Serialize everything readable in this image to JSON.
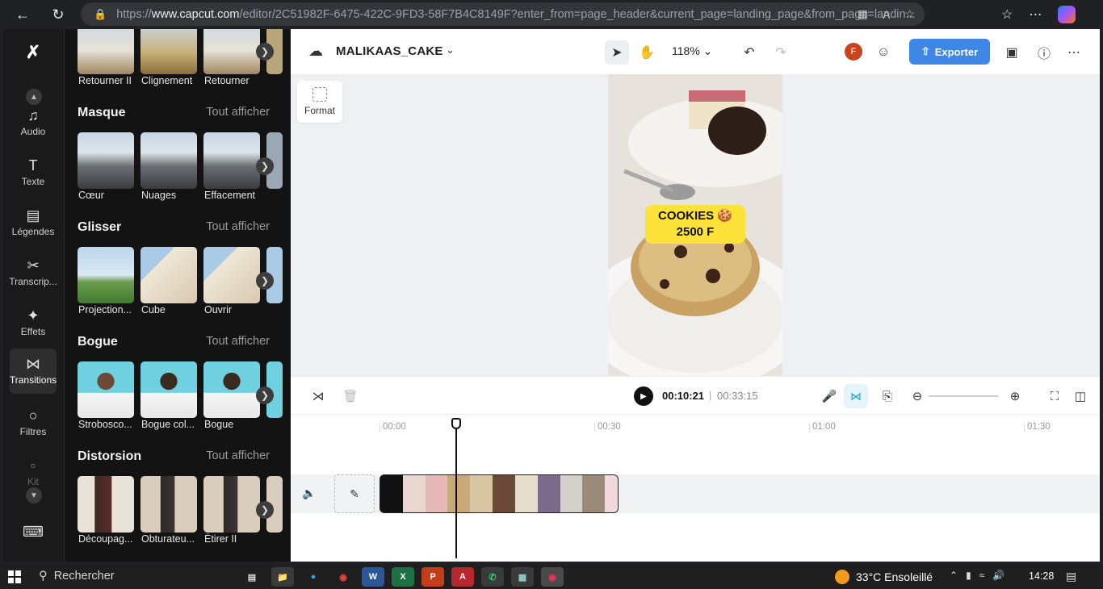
{
  "browser": {
    "url_prefix": "https://",
    "url_host": "www.capcut.com",
    "url_path": "/editor/2C51982F-6475-422C-9FD3-58F7B4C8149F?enter_from=page_header&current_page=landing_page&from_page=landin..."
  },
  "rail": {
    "items": [
      {
        "label": "Audio",
        "icon": "music-note-icon"
      },
      {
        "label": "Texte",
        "icon": "text-icon"
      },
      {
        "label": "Légendes",
        "icon": "captions-icon"
      },
      {
        "label": "Transcrip...",
        "icon": "transcript-icon"
      },
      {
        "label": "Effets",
        "icon": "sparkle-icon"
      },
      {
        "label": "Transitions",
        "icon": "transitions-icon"
      },
      {
        "label": "Filtres",
        "icon": "filters-icon"
      },
      {
        "label": "Kit",
        "icon": "kit-icon"
      }
    ]
  },
  "panel": {
    "top_row": [
      "Retourner II",
      "Clignement",
      "Retourner"
    ],
    "sections": [
      {
        "title": "Masque",
        "more": "Tout afficher",
        "items": [
          "Cœur",
          "Nuages",
          "Effacement"
        ]
      },
      {
        "title": "Glisser",
        "more": "Tout afficher",
        "items": [
          "Projection...",
          "Cube",
          "Ouvrir"
        ]
      },
      {
        "title": "Bogue",
        "more": "Tout afficher",
        "items": [
          "Strobosco...",
          "Bogue col...",
          "Bogue"
        ]
      },
      {
        "title": "Distorsion",
        "more": "Tout afficher",
        "items": [
          "Découpag...",
          "Obturateu...",
          "Étirer II"
        ]
      }
    ]
  },
  "editor": {
    "project_name": "MALIKAAS_CAKE",
    "zoom": "118%",
    "avatar_initial": "F",
    "export_label": "Exporter",
    "format_label": "Format",
    "caption_line1": "COOKIES 🍪",
    "caption_line2": "2500 F",
    "time_current": "00:10:21",
    "time_separator": "|",
    "time_total": "00:33:15",
    "ruler": [
      "00:00",
      "00:30",
      "01:00",
      "01:30"
    ]
  },
  "taskbar": {
    "search": "Rechercher",
    "weather": "33°C  Ensoleillé",
    "clock": "14:28"
  },
  "colors": {
    "accent": "#3f87e6",
    "caption_bg": "#fde23a",
    "panel_bg": "#131313"
  }
}
